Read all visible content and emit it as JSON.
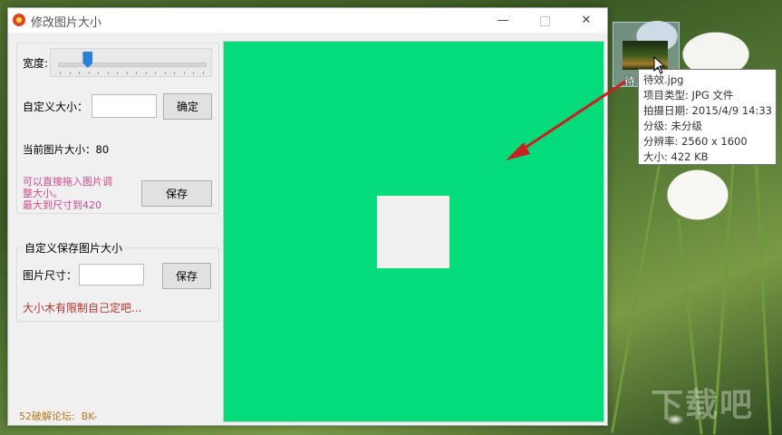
{
  "window": {
    "title": "修改图片大小",
    "minimize_glyph": "—",
    "close_glyph": "✕"
  },
  "resize_group": {
    "width_label": "宽度:",
    "width_slider_fraction": 0.2,
    "custom_size_label": "自定义大小：",
    "custom_size_value": "",
    "confirm_label": "确定",
    "current_size_label": "当前图片大小：",
    "current_size_value": "80",
    "hint_lines": [
      "可以直接拖入图片调",
      "整大小。",
      "最大到尺寸到420"
    ],
    "save_label": "保存"
  },
  "custom_save_group": {
    "legend": "自定义保存图片大小",
    "image_size_label": "图片尺寸：",
    "image_size_value": "",
    "save_label": "保存",
    "note": "大小木有限制自己定吧..."
  },
  "footer": {
    "credit": "52破解论坛:  BK-"
  },
  "preview": {
    "background_color": "#04db7a",
    "image_color": "#f0f0f0"
  },
  "desktop": {
    "file_label": "待",
    "tooltip": {
      "filename": "待效.jpg",
      "type": "项目类型: JPG 文件",
      "date_taken": "拍摄日期: 2015/4/9 14:33",
      "rating": "分级: 未分级",
      "resolution": "分辨率: 2560 x 1600",
      "size": "大小: 422 KB"
    },
    "watermark": "下载吧"
  }
}
